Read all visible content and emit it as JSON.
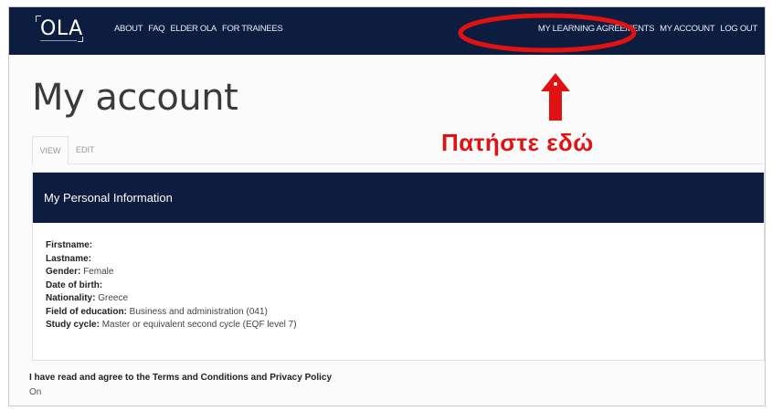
{
  "app": {
    "logo": "OLA"
  },
  "nav": {
    "left": [
      "ABOUT",
      "FAQ",
      "ELDER OLA",
      "FOR TRAINEES"
    ],
    "right": [
      "MY LEARNING AGREEMENTS",
      "MY ACCOUNT",
      "LOG OUT"
    ]
  },
  "page": {
    "title": "My account"
  },
  "tabs": {
    "view": "VIEW",
    "edit": "EDIT"
  },
  "card": {
    "title": "My Personal Information",
    "fields": [
      {
        "label": "Firstname:",
        "value": ""
      },
      {
        "label": "Lastname:",
        "value": ""
      },
      {
        "label": "Gender:",
        "value": "Female"
      },
      {
        "label": "Date of birth:",
        "value": ""
      },
      {
        "label": "Nationality:",
        "value": "Greece"
      },
      {
        "label": "Field of education:",
        "value": "Business and administration (041)"
      },
      {
        "label": "Study cycle:",
        "value": "Master or equivalent second cycle (EQF level 7)"
      }
    ]
  },
  "terms": {
    "label": "I have read and agree to the Terms and Conditions and Privacy Policy",
    "value": "On"
  },
  "annotation": {
    "text": "Πατήστε εδώ",
    "color": "#e31212"
  },
  "colors": {
    "navbar": "#0c1d3f",
    "accent": "#e31212"
  }
}
